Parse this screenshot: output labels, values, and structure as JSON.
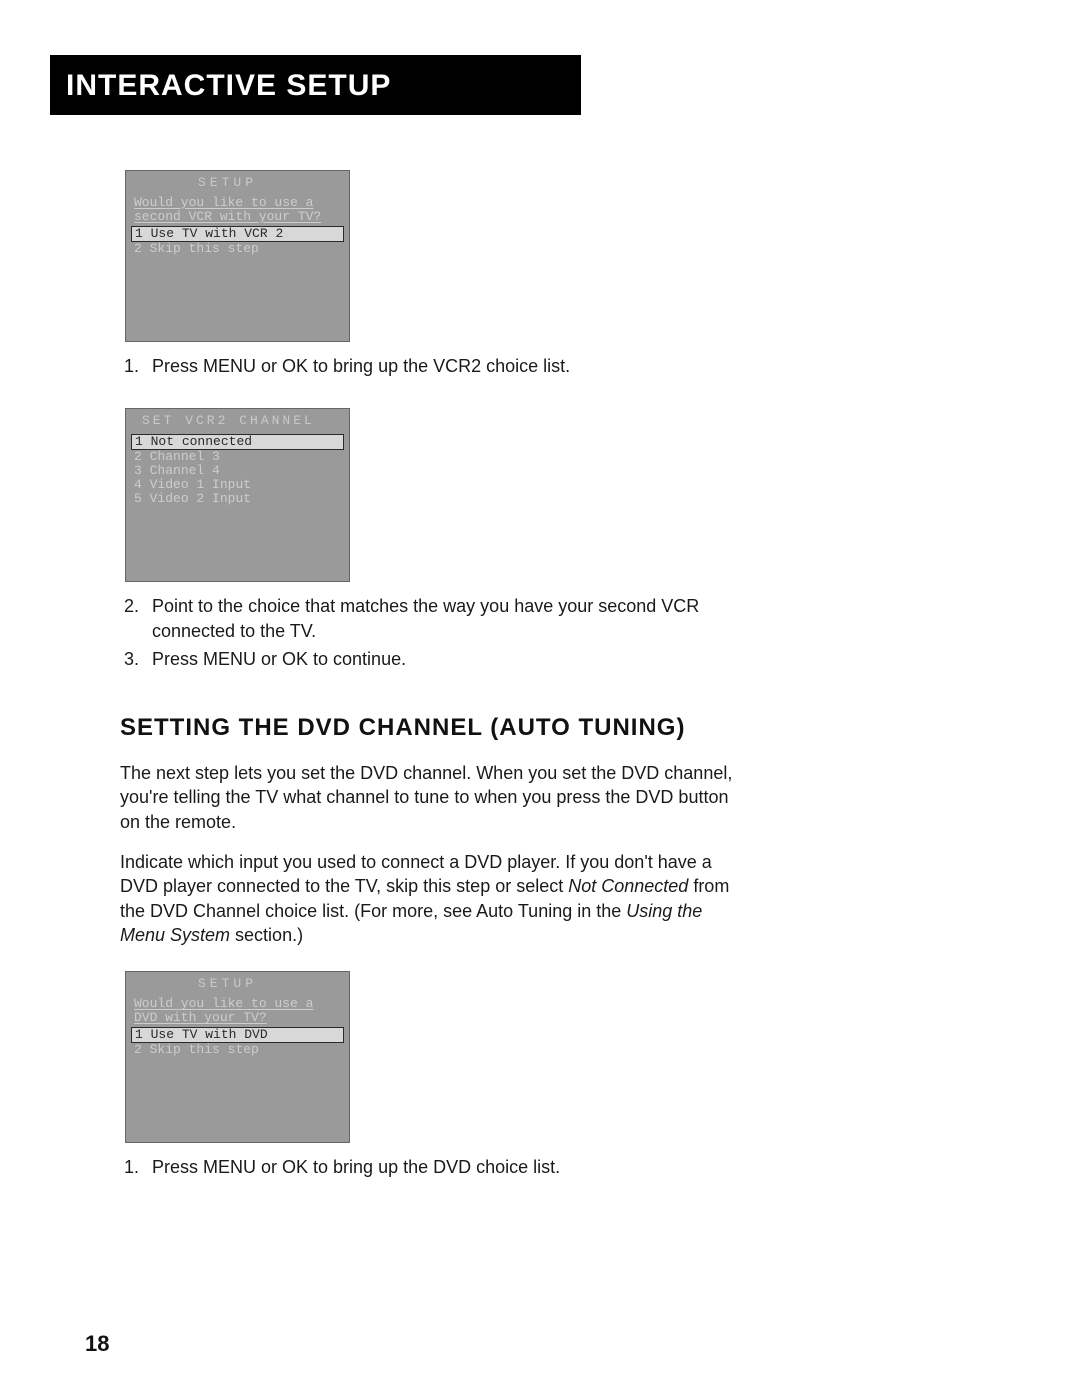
{
  "header": "Interactive Setup",
  "osd1": {
    "title": "SETUP",
    "prompt": "Would you like to use a second VCR with your TV?",
    "options": [
      {
        "num": "1",
        "label": "Use TV with VCR 2",
        "selected": true
      },
      {
        "num": "2",
        "label": "Skip this step",
        "selected": false
      }
    ]
  },
  "steps_a": [
    "Press MENU or OK to bring up the VCR2 choice list."
  ],
  "osd2": {
    "title": "SET VCR2 CHANNEL",
    "options": [
      {
        "num": "1",
        "label": "Not connected",
        "selected": true
      },
      {
        "num": "2",
        "label": "Channel 3",
        "selected": false
      },
      {
        "num": "3",
        "label": "Channel 4",
        "selected": false
      },
      {
        "num": "4",
        "label": "Video 1 Input",
        "selected": false
      },
      {
        "num": "5",
        "label": "Video 2 Input",
        "selected": false
      }
    ]
  },
  "steps_b": [
    "Point to the choice that matches the way you have your second VCR connected to the TV.",
    "Press MENU or OK to continue."
  ],
  "section_heading": "Setting the DVD Channel (Auto Tuning)",
  "para1": "The next step lets you set the DVD channel. When you set the DVD channel, you're telling the TV what channel to tune to when you press the DVD button on the remote.",
  "para2_a": "Indicate which input you used to connect a DVD player. If you don't have a DVD player connected to the TV, skip this step or select ",
  "para2_i1": "Not Connected",
  "para2_b": " from the DVD Channel choice list. (For more, see Auto Tuning in the ",
  "para2_i2": "Using the Menu System",
  "para2_c": " section.)",
  "osd3": {
    "title": "SETUP",
    "prompt": "Would you like to use a DVD with your TV?",
    "options": [
      {
        "num": "1",
        "label": "Use TV with DVD",
        "selected": true
      },
      {
        "num": "2",
        "label": "Skip this step",
        "selected": false
      }
    ]
  },
  "steps_c": [
    "Press MENU or OK to bring up the DVD choice list."
  ],
  "page_number": "18"
}
